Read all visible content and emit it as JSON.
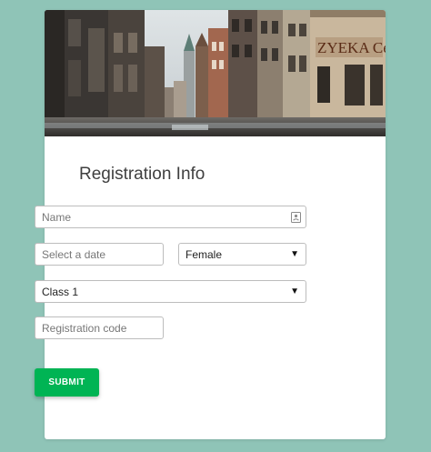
{
  "form": {
    "title": "Registration Info",
    "name_placeholder": "Name",
    "date_placeholder": "Select a date",
    "gender_value": "Female",
    "class_value": "Class 1",
    "code_placeholder": "Registration code",
    "submit_label": "SUBMIT"
  },
  "icons": {
    "name_field": "contact-card-icon",
    "dropdown": "triangle-down-icon"
  },
  "colors": {
    "background": "#8fc4b7",
    "submit": "#00b454",
    "card": "#ffffff"
  }
}
